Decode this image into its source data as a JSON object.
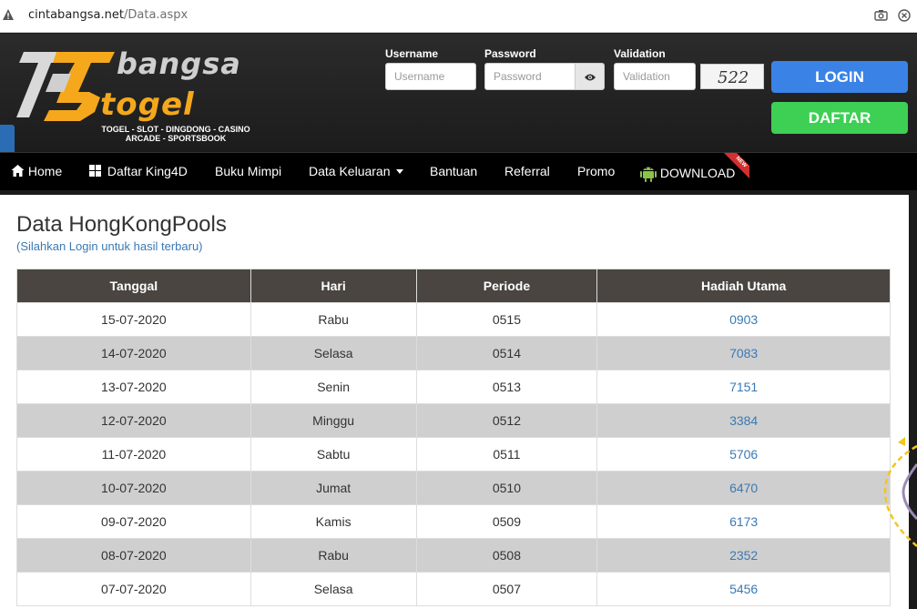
{
  "browser": {
    "url_host": "cintabangsa.net",
    "url_path": "/Data.aspx"
  },
  "brand": {
    "line1": "bangsa",
    "line2": "togel",
    "tagline1": "TOGEL - SLOT - DINGDONG - CASINO",
    "tagline2": "ARCADE - SPORTSBOOK"
  },
  "login_form": {
    "username_label": "Username",
    "username_placeholder": "Username",
    "password_label": "Password",
    "password_placeholder": "Password",
    "validation_label": "Validation",
    "validation_placeholder": "Validation",
    "captcha": "522",
    "login_button": "LOGIN",
    "register_button": "DAFTAR"
  },
  "nav": {
    "home": "Home",
    "daftar_king4d": "Daftar King4D",
    "buku_mimpi": "Buku Mimpi",
    "data_keluaran": "Data Keluaran",
    "bantuan": "Bantuan",
    "referral": "Referral",
    "promo": "Promo",
    "download": "DOWNLOAD",
    "new_badge": "NEW"
  },
  "page": {
    "title": "Data HongKongPools",
    "subtitle": "(Silahkan Login untuk hasil terbaru)"
  },
  "table": {
    "headers": [
      "Tanggal",
      "Hari",
      "Periode",
      "Hadiah Utama"
    ],
    "rows": [
      [
        "15-07-2020",
        "Rabu",
        "0515",
        "0903"
      ],
      [
        "14-07-2020",
        "Selasa",
        "0514",
        "7083"
      ],
      [
        "13-07-2020",
        "Senin",
        "0513",
        "7151"
      ],
      [
        "12-07-2020",
        "Minggu",
        "0512",
        "3384"
      ],
      [
        "11-07-2020",
        "Sabtu",
        "0511",
        "5706"
      ],
      [
        "10-07-2020",
        "Jumat",
        "0510",
        "6470"
      ],
      [
        "09-07-2020",
        "Kamis",
        "0509",
        "6173"
      ],
      [
        "08-07-2020",
        "Rabu",
        "0508",
        "2352"
      ],
      [
        "07-07-2020",
        "Selasa",
        "0507",
        "5456"
      ]
    ]
  },
  "colors": {
    "accent_blue": "#3b82e6",
    "accent_green": "#3ecf55",
    "brand_orange": "#f5a81c",
    "table_header": "#4a4540",
    "link": "#3a79b5"
  }
}
